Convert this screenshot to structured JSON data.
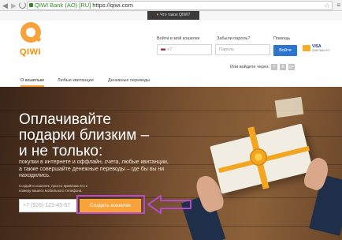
{
  "browser": {
    "ev_name": "QIWI Bank (AO) [RU]",
    "url": "https://qiwi.com"
  },
  "top_tab": {
    "label": "Что такое QIWI?"
  },
  "brand": {
    "logo_text": "QIWI"
  },
  "login": {
    "label": "Войти в мой кошелек",
    "phone_placeholder": "+7",
    "forgot_label": "Забыли пароль?",
    "password_placeholder": "Пароль",
    "help_label": "Помощь",
    "submit_label": "Войти",
    "social_label": "Или войдите через:"
  },
  "visa": {
    "title": "VISA",
    "subtitle": "QIWI WALLET"
  },
  "social": [
    {
      "glyph": "f"
    },
    {
      "glyph": "B"
    },
    {
      "glyph": "g+"
    }
  ],
  "nav": {
    "tabs": [
      {
        "label": "О кошельке",
        "active": true
      },
      {
        "label": "Любые квитанции",
        "active": false
      },
      {
        "label": "Денежные переводы",
        "active": false
      }
    ]
  },
  "hero": {
    "headline_1": "Оплачивайте",
    "headline_2": "подарки близким –",
    "headline_3": "и не только:",
    "subtext": "покупки в интернете и оффлайн, счета, любые квитанции, а также совершайте денежные переводы – где бы вы ни находились.",
    "hint": "Создайте кошелек, просто привязав его к номеру вашего мобильного телефона.",
    "phone_placeholder": "+7 (926) 123-45-67",
    "cta_label": "Создать кошелек"
  },
  "colors": {
    "accent": "#f8a23b",
    "login_button": "#2a75d0",
    "annotation": "#b44bc8"
  }
}
